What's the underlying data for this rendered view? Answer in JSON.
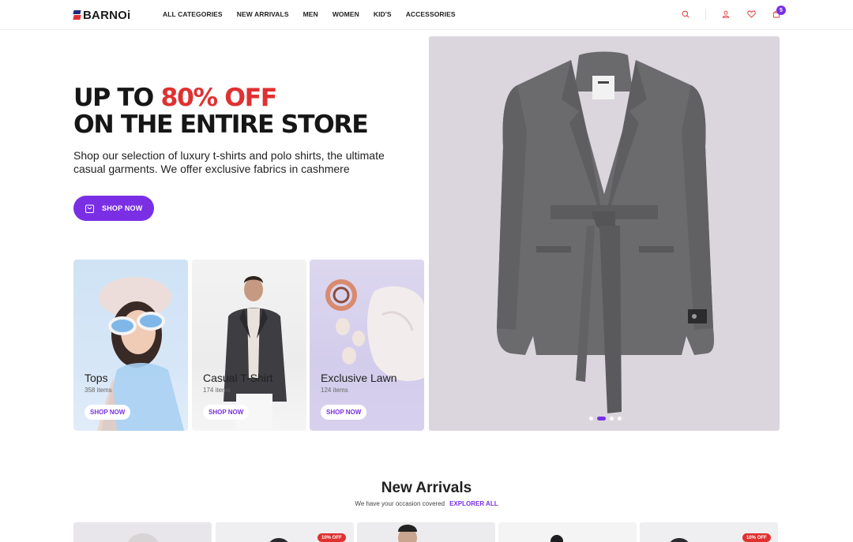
{
  "brand": {
    "logo_text": "BARNOi"
  },
  "nav": {
    "items": [
      "ALL CATEGORIES",
      "NEW ARRIVALS",
      "MEN",
      "WOMEN",
      "KID'S",
      "ACCESSORIES"
    ]
  },
  "header_icons": {
    "search": "search-icon",
    "account": "user-icon",
    "wishlist": "heart-icon",
    "cart": "cart-icon",
    "cart_count": "5"
  },
  "hero": {
    "line1_prefix": "UP TO ",
    "line1_accent": "80% OFF",
    "line2": "ON THE ENTIRE STORE",
    "subtitle": "Shop our selection of luxury t-shirts and polo shirts, the ultimate casual garments. We offer exclusive fabrics in cashmere",
    "cta_label": "SHOP NOW",
    "slides": 4,
    "active_slide": 2
  },
  "categories": [
    {
      "name": "Tops",
      "count": "358 items",
      "cta": "SHOP NOW"
    },
    {
      "name": "Casual T-Shirt",
      "count": "174 items",
      "cta": "SHOP NOW"
    },
    {
      "name": "Exclusive Lawn",
      "count": "124 items",
      "cta": "SHOP NOW"
    }
  ],
  "new_arrivals": {
    "title": "New Arrivals",
    "subtitle": "We have your occasion covered",
    "link": "EXPLORER ALL",
    "badges": [
      "10% OFF",
      "10% OFF"
    ]
  },
  "colors": {
    "accent": "#7a2fe5",
    "sale": "#e03131",
    "hero_panel": "#dbd6de"
  }
}
